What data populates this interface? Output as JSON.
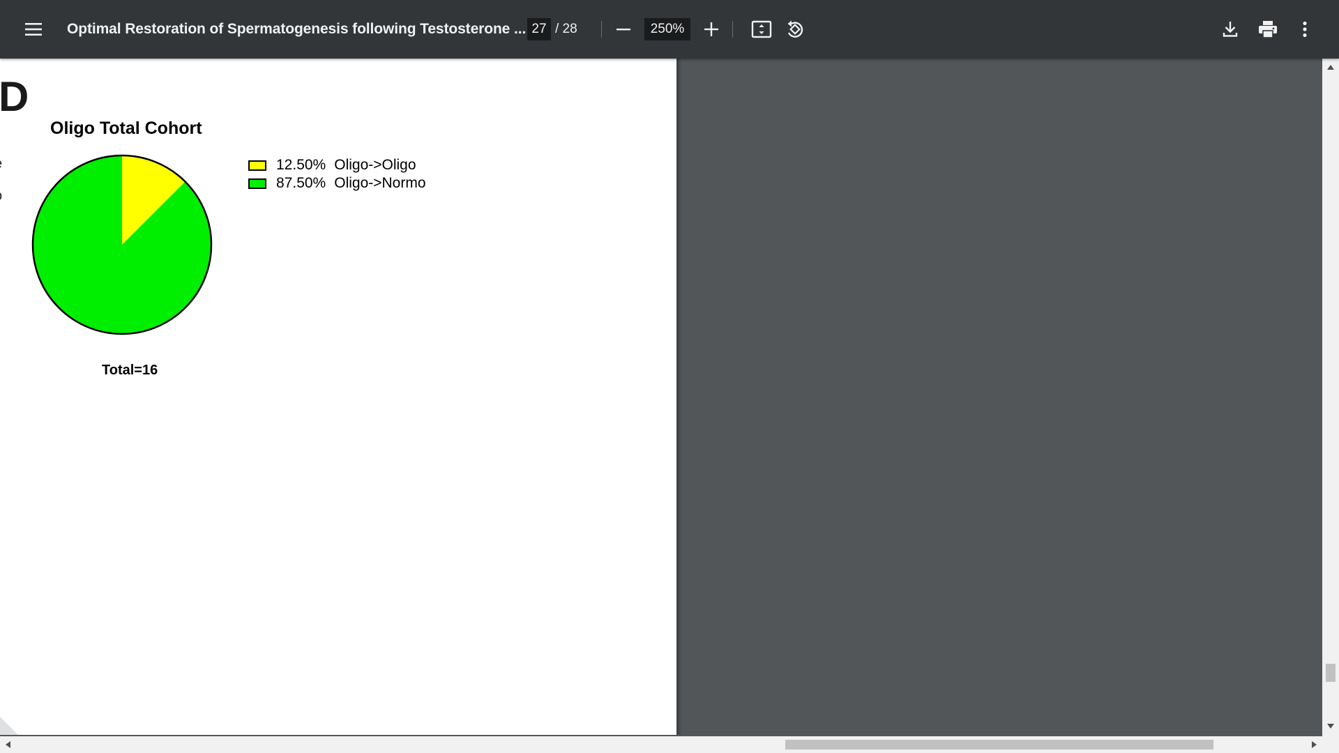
{
  "toolbar": {
    "menu_icon": "hamburger-menu-icon",
    "title": "Optimal Restoration of Spermatogenesis following Testosterone ...",
    "page_current": "27",
    "page_total": "/ 28",
    "zoom_out_icon": "minus-icon",
    "zoom_value": "250%",
    "zoom_in_icon": "plus-icon",
    "fit_icon": "fit-to-page-icon",
    "rotate_icon": "rotate-counterclockwise-icon",
    "download_icon": "download-icon",
    "print_icon": "print-icon",
    "more_icon": "more-vert-icon"
  },
  "document": {
    "panel_label": "D",
    "total_label": "Total=16",
    "edge_glyphs": [
      "e",
      "o"
    ]
  },
  "chart_data": {
    "type": "pie",
    "title": "Oligo Total Cohort",
    "slices": [
      {
        "label": "Oligo->Oligo",
        "pct_label": "12.50%",
        "value": 12.5,
        "color": "#ffff00"
      },
      {
        "label": "Oligo->Normo",
        "pct_label": "87.50%",
        "value": 87.5,
        "color": "#00ee00"
      }
    ],
    "legend_position": "right"
  },
  "colors": {
    "toolbar_bg": "#323639",
    "viewer_bg": "#525659",
    "page_bg": "#ffffff"
  }
}
